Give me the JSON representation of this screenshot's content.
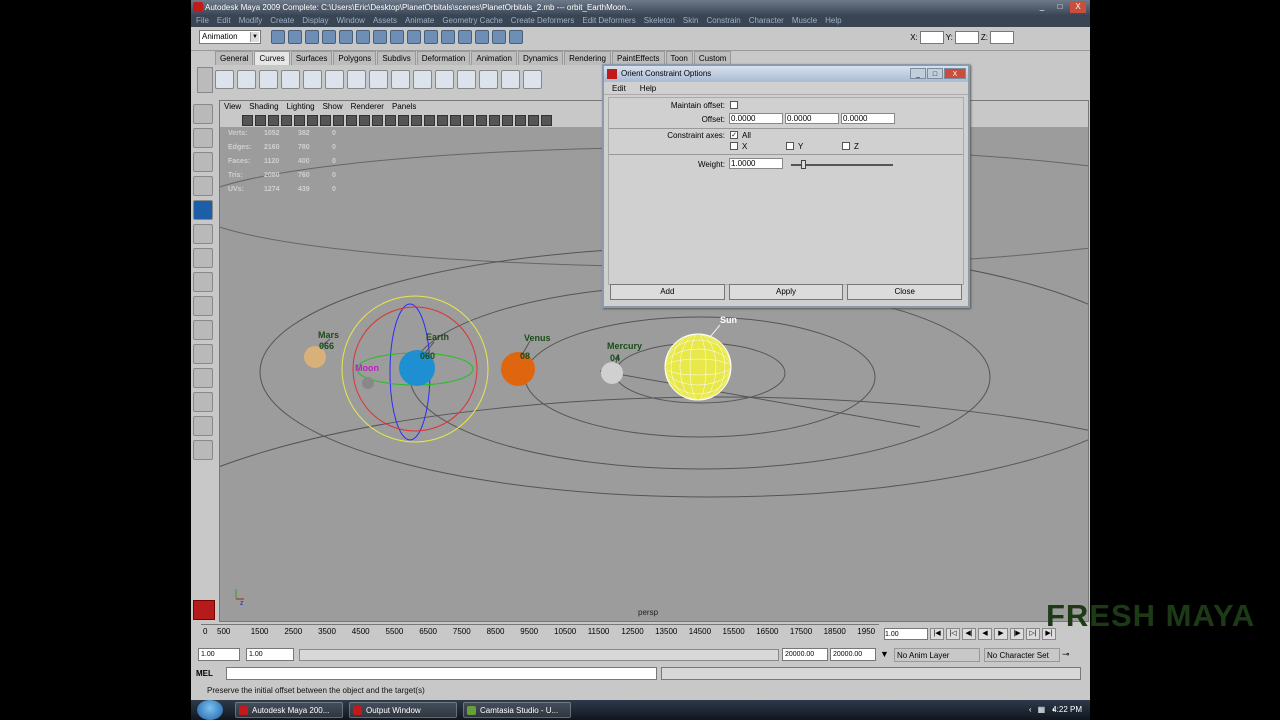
{
  "window": {
    "title": "Autodesk Maya 2009 Complete: C:\\Users\\Eric\\Desktop\\PlanetOrbitals\\scenes\\PlanetOrbitals_2.mb   ---   orbit_EarthMoon...",
    "buttons": [
      "_",
      "□",
      "X"
    ]
  },
  "menubar": [
    "File",
    "Edit",
    "Modify",
    "Create",
    "Display",
    "Window",
    "Assets",
    "Animate",
    "Geometry Cache",
    "Create Deformers",
    "Edit Deformers",
    "Skeleton",
    "Skin",
    "Constrain",
    "Character",
    "Muscle",
    "Help"
  ],
  "statusline": {
    "mode": "Animation",
    "x_label": "X:",
    "y_label": "Y:",
    "z_label": "Z:"
  },
  "shelf": {
    "tabs": [
      "General",
      "Curves",
      "Surfaces",
      "Polygons",
      "Subdivs",
      "Deformation",
      "Animation",
      "Dynamics",
      "Rendering",
      "PaintEffects",
      "Toon",
      "Custom"
    ],
    "active": "Curves"
  },
  "viewport": {
    "menu": [
      "View",
      "Shading",
      "Lighting",
      "Show",
      "Renderer",
      "Panels"
    ],
    "hud": [
      {
        "label": "Verts:",
        "a": "1052",
        "b": "382",
        "c": "0"
      },
      {
        "label": "Edges:",
        "a": "2160",
        "b": "780",
        "c": "0"
      },
      {
        "label": "Faces:",
        "a": "1120",
        "b": "400",
        "c": "0"
      },
      {
        "label": "Tris:",
        "a": "2080",
        "b": "760",
        "c": "0"
      },
      {
        "label": "UVs:",
        "a": "1274",
        "b": "439",
        "c": "0"
      }
    ],
    "camera": "persp",
    "labels": {
      "sun": "Sun",
      "mercury": "Mercury",
      "mercury_num": "04",
      "venus": "Venus",
      "venus_num": "08",
      "earth": "Earth",
      "earth_num": "060",
      "moon": "Moon",
      "mars": "Mars",
      "mars_num": "066"
    },
    "colors": {
      "sun": "#e8e84a",
      "earth": "#1e8fd0",
      "venus": "#e0650f",
      "mercury": "#c9c9c9",
      "mars": "#d8b07a",
      "moon": "#888888",
      "label_green": "#1a4d1a",
      "moon_label": "#c020c0"
    }
  },
  "timeline": {
    "ticks": [
      "0",
      "500",
      "1500",
      "2500",
      "3500",
      "4500",
      "5500",
      "6500",
      "7500",
      "8500",
      "9500",
      "10500",
      "11500",
      "12500",
      "13500",
      "14500",
      "15500",
      "16500",
      "17500",
      "18500",
      "1950"
    ],
    "current": "1.00"
  },
  "range": {
    "start": "1.00",
    "playback_start": "1.00",
    "playback_end": "20000.00",
    "end": "20000.00",
    "anim_layer": "No Anim Layer",
    "char_set": "No Character Set"
  },
  "cmdline": {
    "label": "MEL"
  },
  "helpline": "Preserve the initial offset between the object and the target(s)",
  "dialog": {
    "title": "Orient Constraint Options",
    "menu": [
      "Edit",
      "Help"
    ],
    "maintain_offset_label": "Maintain offset:",
    "offset_label": "Offset:",
    "offset": [
      "0.0000",
      "0.0000",
      "0.0000"
    ],
    "constraint_axes_label": "Constraint axes:",
    "all_label": "All",
    "x_label": "X",
    "y_label": "Y",
    "z_label": "Z",
    "weight_label": "Weight:",
    "weight": "1.0000",
    "weight_level": 0.1,
    "buttons": {
      "add": "Add",
      "apply": "Apply",
      "close": "Close"
    }
  },
  "taskbar": {
    "tasks": [
      "Autodesk Maya 200...",
      "Output Window",
      "Camtasia Studio - U..."
    ],
    "clock": "4:22 PM"
  },
  "watermark": "FRESH MAYA"
}
